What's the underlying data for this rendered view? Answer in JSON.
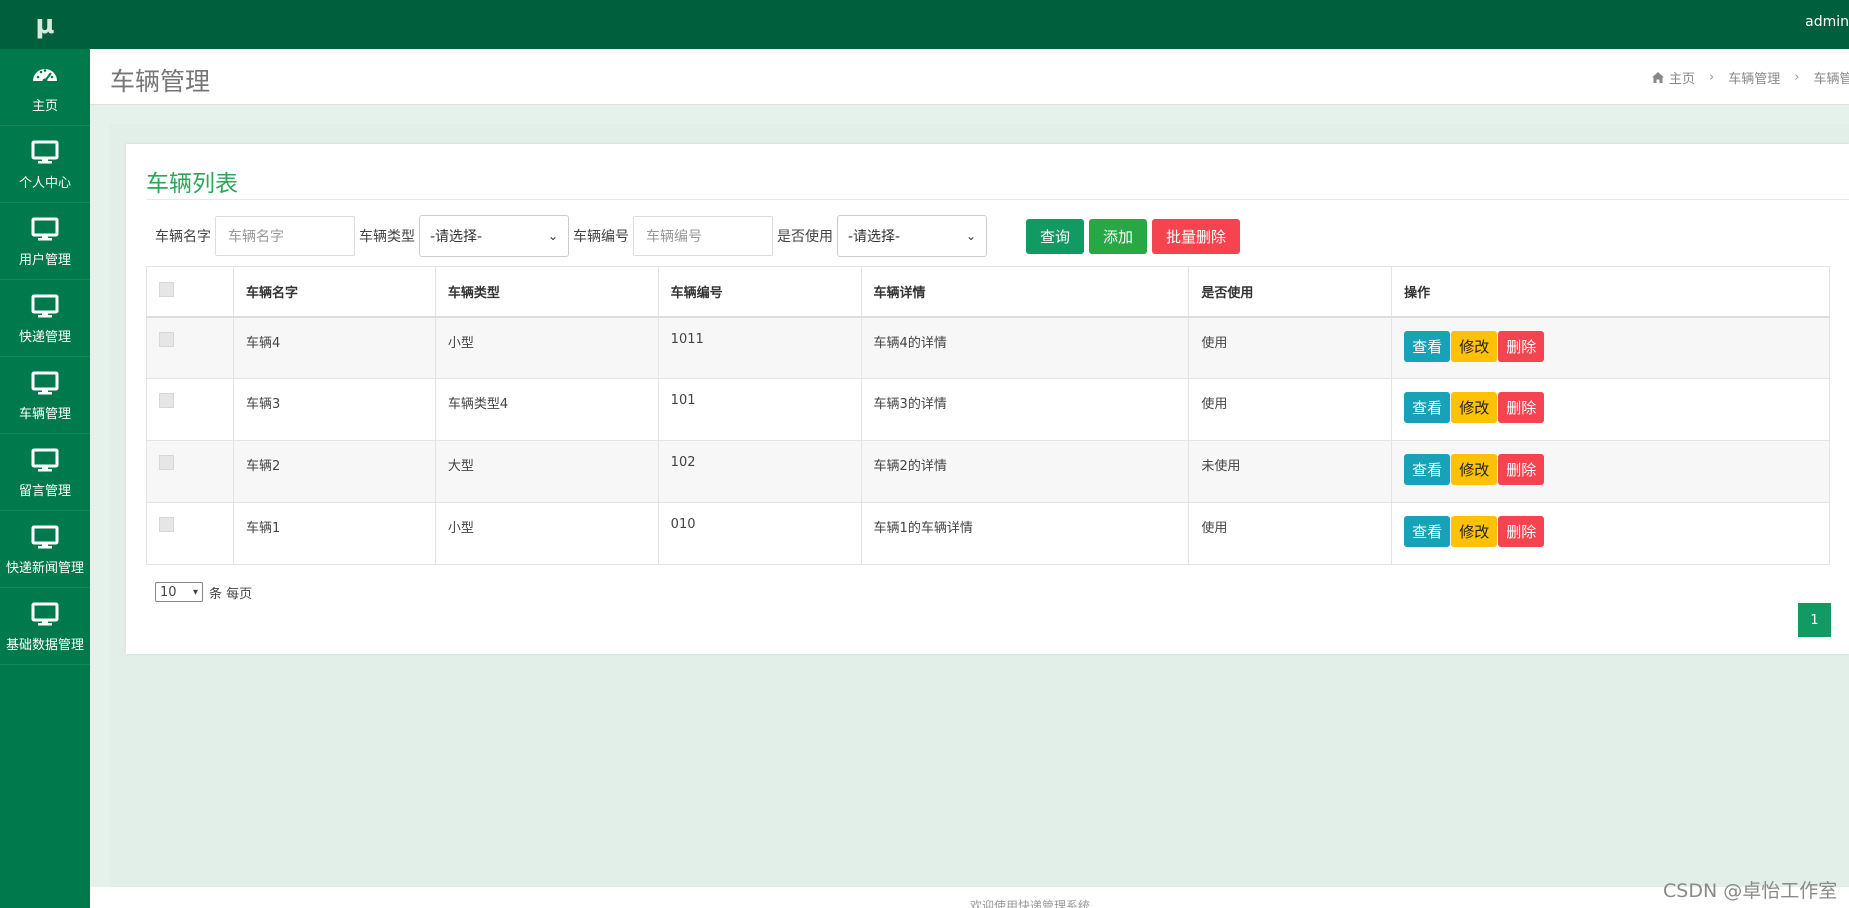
{
  "logo": "μ",
  "topbar": {
    "user": "admin"
  },
  "sidebar": {
    "items": [
      {
        "label": "主页",
        "icon": "dashboard-icon"
      },
      {
        "label": "个人中心",
        "icon": "monitor-icon"
      },
      {
        "label": "用户管理",
        "icon": "monitor-icon"
      },
      {
        "label": "快递管理",
        "icon": "monitor-icon"
      },
      {
        "label": "车辆管理",
        "icon": "monitor-icon"
      },
      {
        "label": "留言管理",
        "icon": "monitor-icon"
      },
      {
        "label": "快递新闻管理",
        "icon": "monitor-icon"
      },
      {
        "label": "基础数据管理",
        "icon": "monitor-icon"
      }
    ]
  },
  "header": {
    "title": "车辆管理",
    "breadcrumb": [
      "主页",
      "车辆管理",
      "车辆管"
    ]
  },
  "card": {
    "title": "车辆列表"
  },
  "search": {
    "name_label": "车辆名字",
    "name_placeholder": "车辆名字",
    "type_label": "车辆类型",
    "type_value": "-请选择-",
    "number_label": "车辆编号",
    "number_placeholder": "车辆编号",
    "used_label": "是否使用",
    "used_value": "-请选择-",
    "query_button": "查询",
    "add_button": "添加",
    "bulk_delete_button": "批量删除"
  },
  "table": {
    "headers": [
      "车辆名字",
      "车辆类型",
      "车辆编号",
      "车辆详情",
      "是否使用",
      "操作"
    ],
    "rows": [
      {
        "name": "车辆4",
        "type": "小型",
        "number": "1011",
        "detail": "车辆4的详情",
        "used": "使用"
      },
      {
        "name": "车辆3",
        "type": "车辆类型4",
        "number": "101",
        "detail": "车辆3的详情",
        "used": "使用"
      },
      {
        "name": "车辆2",
        "type": "大型",
        "number": "102",
        "detail": "车辆2的详情",
        "used": "未使用"
      },
      {
        "name": "车辆1",
        "type": "小型",
        "number": "010",
        "detail": "车辆1的车辆详情",
        "used": "使用"
      }
    ],
    "actions": {
      "view": "查看",
      "edit": "修改",
      "delete": "删除"
    }
  },
  "pagination": {
    "page_size": "10",
    "page_size_suffix": "条 每页",
    "current_page": "1"
  },
  "footer": {
    "text": "欢迎使用快递管理系统"
  },
  "watermark": "CSDN @卓怡工作室",
  "colors": {
    "sidebar": "#007a4d",
    "topbar": "#00603d",
    "accent": "#119a62",
    "title_green": "#2ea55b",
    "view": "#17a2b8",
    "edit": "#ffc107",
    "delete": "#f5434f"
  }
}
